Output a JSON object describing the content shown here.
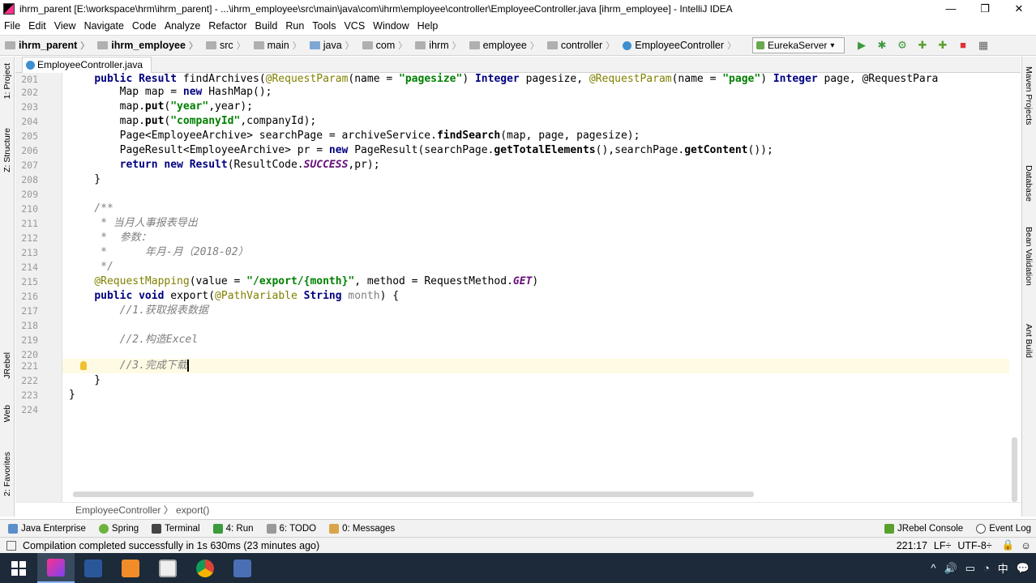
{
  "window": {
    "title": "ihrm_parent [E:\\workspace\\hrm\\ihrm_parent] - ...\\ihrm_employee\\src\\main\\java\\com\\ihrm\\employee\\controller\\EmployeeController.java [ihrm_employee] - IntelliJ IDEA",
    "minimize": "—",
    "maximize": "❐",
    "close": "✕"
  },
  "menu": [
    "File",
    "Edit",
    "View",
    "Navigate",
    "Code",
    "Analyze",
    "Refactor",
    "Build",
    "Run",
    "Tools",
    "VCS",
    "Window",
    "Help"
  ],
  "breadcrumbs": [
    "ihrm_parent",
    "ihrm_employee",
    "src",
    "main",
    "java",
    "com",
    "ihrm",
    "employee",
    "controller",
    "EmployeeController"
  ],
  "run_config": "EurekaServer",
  "left_tools": [
    "1: Project",
    "Z: Structure",
    "JRebel",
    "Web",
    "2: Favorites"
  ],
  "right_tools": [
    "Maven Projects",
    "Database",
    "Bean Validation",
    "Ant Build"
  ],
  "tab": "EmployeeController.java",
  "editor": {
    "line_numbers": [
      "201",
      "202",
      "203",
      "204",
      "205",
      "206",
      "207",
      "208",
      "209",
      "210",
      "211",
      "212",
      "213",
      "214",
      "215",
      "216",
      "217",
      "218",
      "219",
      "220",
      "221",
      "222",
      "223",
      "224"
    ],
    "lines": [
      "    public Result findArchives(@RequestParam(name = \"pagesize\") Integer pagesize, @RequestParam(name = \"page\") Integer page, @RequestPara",
      "        Map map = new HashMap();",
      "        map.put(\"year\",year);",
      "        map.put(\"companyId\",companyId);",
      "        Page<EmployeeArchive> searchPage = archiveService.findSearch(map, page, pagesize);",
      "        PageResult<EmployeeArchive> pr = new PageResult(searchPage.getTotalElements(),searchPage.getContent());",
      "        return new Result(ResultCode.SUCCESS,pr);",
      "    }",
      "",
      "    /**",
      "     * 当月人事报表导出",
      "     *  参数：",
      "     *      年月-月（2018-02）",
      "     */",
      "    @RequestMapping(value = \"/export/{month}\", method = RequestMethod.GET)",
      "    public void export(@PathVariable String month) {",
      "        //1.获取报表数据",
      "",
      "        //2.构造Excel",
      "",
      "        //3.完成下载",
      "    }",
      "}",
      ""
    ]
  },
  "editor_breadcrumb": "EmployeeController  〉 export()",
  "bottom_tools": [
    "Java Enterprise",
    "Spring",
    "Terminal",
    "4: Run",
    "6: TODO",
    "0: Messages",
    "JRebel Console",
    "Event Log"
  ],
  "status": {
    "message": "Compilation completed successfully in 1s 630ms (23 minutes ago)",
    "position": "221:17",
    "line_sep": "LF÷",
    "encoding": "UTF-8÷"
  },
  "tray": [
    "^",
    "🔊",
    "中",
    "💬"
  ]
}
